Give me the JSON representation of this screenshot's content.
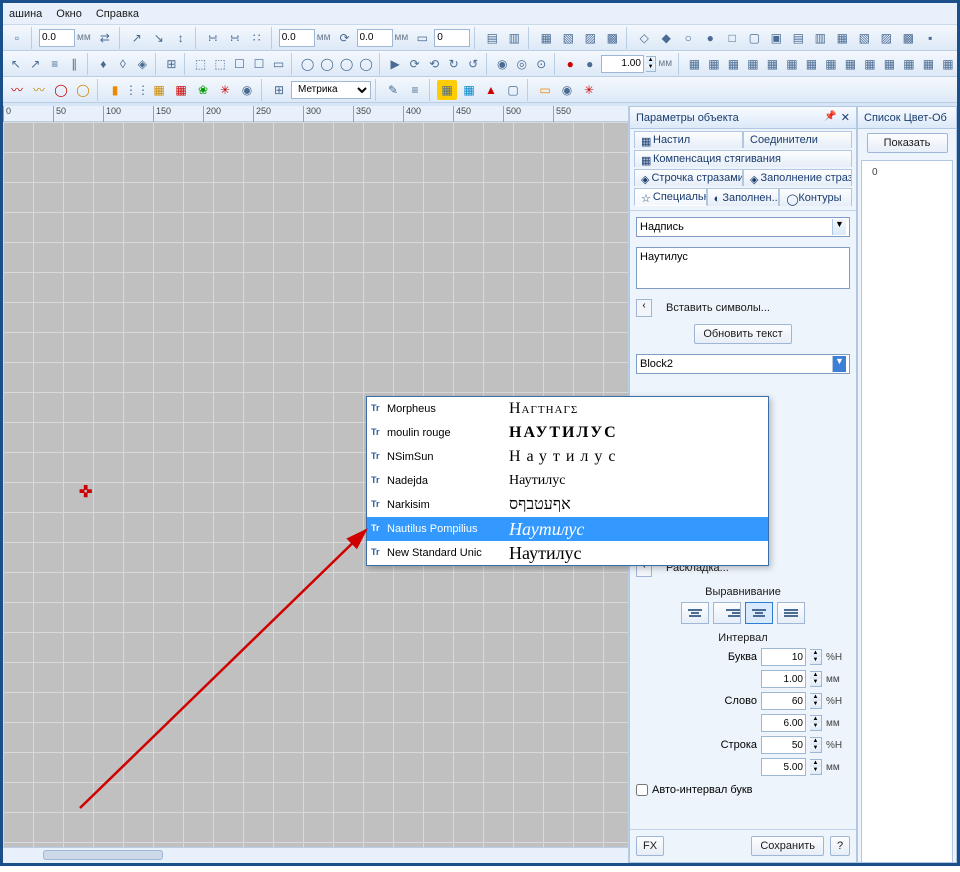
{
  "menu": {
    "items": [
      "ашина",
      "Окно",
      "Справка"
    ]
  },
  "toolbar1": {
    "numA": "0.0",
    "unitA": "мм",
    "numB": "0.0",
    "unitB": "мм"
  },
  "toolbar2": {
    "spinVal": "1.00",
    "unit": "мм"
  },
  "toolbar3": {
    "combo": "Метрика"
  },
  "ruler": {
    "ticks": [
      0,
      50,
      100,
      150,
      200,
      250,
      300,
      350,
      400,
      450,
      500,
      550
    ]
  },
  "panel": {
    "title": "Параметры объекта",
    "tabs": {
      "row1": [
        "Настил",
        "Соединители"
      ],
      "row2": [
        "Компенсация стягивания"
      ],
      "row3": [
        "Строчка стразами",
        "Заполнение страза..."
      ],
      "row4": [
        "Специальн...",
        "Заполнен...",
        "Контуры"
      ]
    },
    "typeCombo": "Надпись",
    "textValue": "Наутилус",
    "insertSymbols": "Вставить символы...",
    "updateText": "Обновить текст",
    "fontCombo": "Block2",
    "layoutBtn": "Раскладка...",
    "alignTitle": "Выравнивание",
    "intervalTitle": "Интервал",
    "props": {
      "letterLabel": "Буква",
      "letterVal": "10",
      "letterUnit": "%H",
      "letterMm": "1.00",
      "mm": "мм",
      "wordLabel": "Слово",
      "wordVal": "60",
      "wordUnit": "%H",
      "wordMm": "6.00",
      "lineLabel": "Строка",
      "lineVal": "50",
      "lineUnit": "%H",
      "lineMm": "5.00"
    },
    "autoInterval": "Авто-интервал букв",
    "fx": "FX",
    "save": "Сохранить",
    "q": "?"
  },
  "rightPanel": {
    "title": "Список Цвет-Об",
    "showBtn": "Показать",
    "zero": "0"
  },
  "fonts": [
    {
      "name": "Morpheus",
      "preview": "Ηαγτηαγς",
      "style": "font-family: 'Palatino Linotype', serif; font-variant: small-caps; letter-spacing:1px;"
    },
    {
      "name": "moulin rouge",
      "preview": "НАУТИЛУС",
      "style": "font-family: Georgia, serif; font-weight:bold; letter-spacing:2px;"
    },
    {
      "name": "NSimSun",
      "preview": "Наутилус",
      "style": "font-family: 'Times New Roman', serif; letter-spacing:6px;"
    },
    {
      "name": "Nadejda",
      "preview": "Наутилус",
      "style": "font-family: 'Segoe Script', cursive; font-size:14px;"
    },
    {
      "name": "Narkisim",
      "preview": "אףעטבףס",
      "style": "font-family: serif; direction:rtl;"
    },
    {
      "name": "Nautilus Pompilius",
      "preview": "Наутилус",
      "style": "font-family: 'Brush Script MT', cursive; font-style:italic; font-size:18px;",
      "selected": true
    },
    {
      "name": "New Standard Unic",
      "preview": "Наутилус",
      "style": "font-family: 'Times New Roman', serif; font-size:18px;"
    }
  ]
}
